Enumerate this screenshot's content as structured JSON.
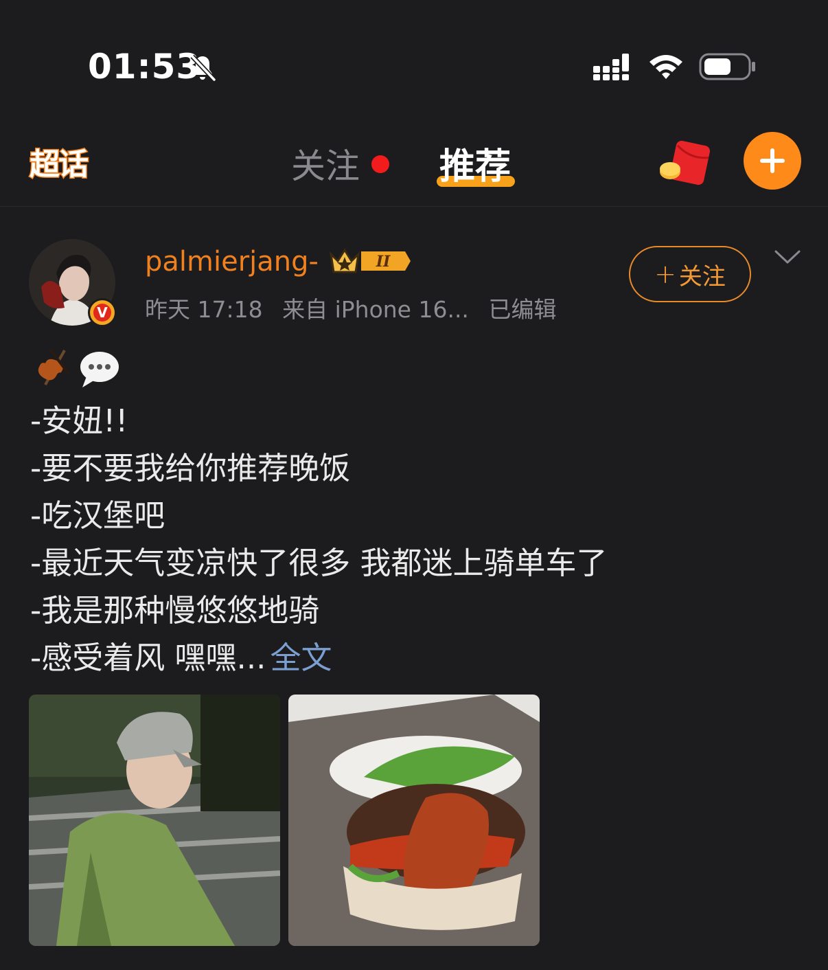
{
  "status_bar": {
    "time": "01:53",
    "icons": [
      "bell-slash-icon",
      "signal-icon",
      "wifi-icon",
      "battery-icon"
    ]
  },
  "nav": {
    "supertopic_label": "超话",
    "tabs": [
      {
        "label": "关注",
        "has_dot": true,
        "active": false
      },
      {
        "label": "推荐",
        "active": true
      }
    ],
    "icons": [
      "red-packet-icon",
      "plus-icon"
    ],
    "colors": {
      "accent": "#fe8a1a",
      "underline": "#f8a11a",
      "dot": "#f21c1c"
    }
  },
  "post": {
    "username": "palmierjang-",
    "vip_badge_text": "II",
    "verified_badge": "V",
    "meta": {
      "time": "昨天 17:18",
      "source": "来自 iPhone 16...",
      "edited": "已编辑"
    },
    "follow_button": {
      "plus": "+",
      "label": "关注"
    },
    "emojis": [
      "🎻",
      "💬"
    ],
    "lines": [
      "-安妞!!",
      "-要不要我给你推荐晚饭",
      "-吃汉堡吧",
      "-最近天气变凉快了很多 我都迷上骑单车了",
      "-我是那种慢悠悠地骑",
      "-感受着风 嘿嘿..."
    ],
    "full_text_link": "全文",
    "images": [
      "selfie-photo",
      "burger-photo"
    ]
  }
}
